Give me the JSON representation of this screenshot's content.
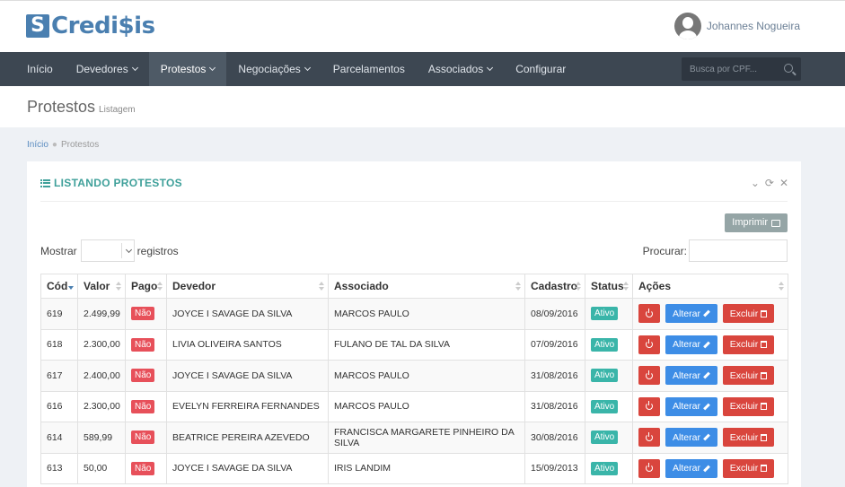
{
  "brand": {
    "mark": "S",
    "name": "Credi$is"
  },
  "user": {
    "name": "Johannes Nogueira"
  },
  "nav": {
    "items": [
      {
        "label": "Início",
        "dropdown": false
      },
      {
        "label": "Devedores",
        "dropdown": true
      },
      {
        "label": "Protestos",
        "dropdown": true,
        "active": true
      },
      {
        "label": "Negociações",
        "dropdown": true
      },
      {
        "label": "Parcelamentos",
        "dropdown": false
      },
      {
        "label": "Associados",
        "dropdown": true
      },
      {
        "label": "Configurar",
        "dropdown": false
      }
    ],
    "search_placeholder": "Busca por CPF..."
  },
  "page": {
    "title": "Protestos",
    "subtitle": "Listagem"
  },
  "breadcrumb": {
    "home": "Início",
    "current": "Protestos"
  },
  "portlet": {
    "title": "LISTANDO PROTESTOS",
    "print_label": "Imprimir"
  },
  "table_controls": {
    "show_label": "Mostrar",
    "records_label": "registros",
    "search_label": "Procurar:"
  },
  "table": {
    "headers": [
      "Cód",
      "Valor",
      "Pago",
      "Devedor",
      "Associado",
      "Cadastro",
      "Status",
      "Ações"
    ],
    "rows": [
      {
        "cod": "619",
        "valor": "2.499,99",
        "pago": "Não",
        "devedor": "JOYCE I SAVAGE DA SILVA",
        "associado": "MARCOS PAULO",
        "cadastro": "08/09/2016",
        "status": "Ativo"
      },
      {
        "cod": "618",
        "valor": "2.300,00",
        "pago": "Não",
        "devedor": "LIVIA OLIVEIRA SANTOS",
        "associado": "FULANO DE TAL DA SILVA",
        "cadastro": "07/09/2016",
        "status": "Ativo"
      },
      {
        "cod": "617",
        "valor": "2.400,00",
        "pago": "Não",
        "devedor": "JOYCE I SAVAGE DA SILVA",
        "associado": "MARCOS PAULO",
        "cadastro": "31/08/2016",
        "status": "Ativo"
      },
      {
        "cod": "616",
        "valor": "2.300,00",
        "pago": "Não",
        "devedor": "EVELYN FERREIRA FERNANDES",
        "associado": "MARCOS PAULO",
        "cadastro": "31/08/2016",
        "status": "Ativo"
      },
      {
        "cod": "614",
        "valor": "589,99",
        "pago": "Não",
        "devedor": "BEATRICE PEREIRA AZEVEDO",
        "associado": "FRANCISCA MARGARETE PINHEIRO DA SILVA",
        "cadastro": "30/08/2016",
        "status": "Ativo"
      },
      {
        "cod": "613",
        "valor": "50,00",
        "pago": "Não",
        "devedor": "JOYCE I SAVAGE DA SILVA",
        "associado": "IRIS LANDIM",
        "cadastro": "15/09/2013",
        "status": "Ativo"
      }
    ],
    "actions": {
      "edit_label": "Alterar",
      "delete_label": "Excluir"
    }
  },
  "colors": {
    "nav_bg": "#3d4752",
    "brand": "#4a7fb0",
    "accent": "#3fa09a",
    "danger": "#d9453d",
    "primary": "#3d8de6"
  }
}
